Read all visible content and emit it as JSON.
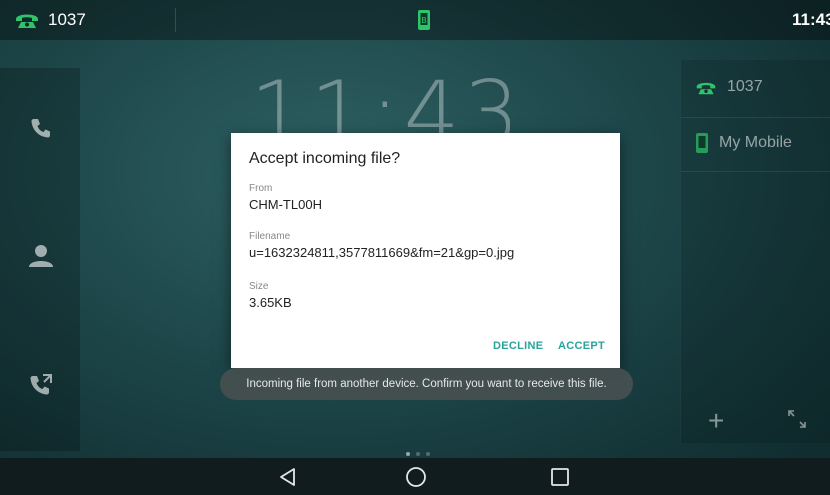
{
  "status_bar": {
    "account": "1037",
    "time": "11:43"
  },
  "home": {
    "clock": "11:43"
  },
  "right_panel": {
    "items": [
      {
        "label": "1037",
        "icon": "phone-icon"
      },
      {
        "label": "My Mobile",
        "icon": "mobile-icon"
      }
    ]
  },
  "dialog": {
    "title": "Accept incoming file?",
    "from_label": "From",
    "from_value": "CHM-TL00H",
    "filename_label": "Filename",
    "filename_value": "u=1632324811,3577811669&fm=21&gp=0.jpg",
    "size_label": "Size",
    "size_value": "3.65KB",
    "decline_label": "DECLINE",
    "accept_label": "ACCEPT"
  },
  "toast": {
    "text": "Incoming file from another device. Confirm you want to receive this file."
  },
  "colors": {
    "accent": "#2aa39a",
    "phone_green": "#2fc46a",
    "background": "#1d4649"
  }
}
